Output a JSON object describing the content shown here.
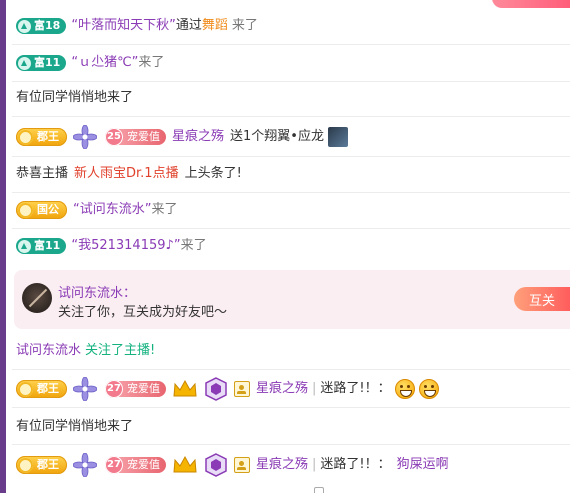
{
  "feed": {
    "rows": [
      {
        "badge_level": "富18",
        "user": "叶落而知天下秋",
        "action_pre": "通过",
        "source": "舞蹈",
        "action_post": "来了"
      },
      {
        "badge_level": "富11",
        "user": "ｕ尐猪℃",
        "action_post": "来了"
      },
      {
        "text": "有位同学悄悄地来了"
      },
      {
        "badge": "郡王",
        "love_level": "25",
        "love_label": "宠爱值",
        "user": "星痕之殇",
        "gift_text": "送1个翔翼•应龙"
      },
      {
        "pre": "恭喜主播",
        "anchor": "新人雨宝Dr.1点播",
        "post": "上头条了!"
      },
      {
        "badge": "国公",
        "user": "试问东流水",
        "action_post": "来了"
      },
      {
        "badge_level": "富11",
        "user": "我521314159♪",
        "action_post": "来了"
      },
      {
        "user": "试问东流水",
        "action": "关注了主播!"
      },
      {
        "badge": "郡王",
        "love_level": "27",
        "love_label": "宠爱值",
        "user": "星痕之殇",
        "sep": "|",
        "message": "迷路了!！："
      },
      {
        "text": "有位同学悄悄地来了"
      },
      {
        "badge": "郡王",
        "love_level": "27",
        "love_label": "宠爱值",
        "user": "星痕之殇",
        "sep": "|",
        "message": "迷路了!！：",
        "extra": "狗屎运啊"
      }
    ],
    "quote_open": "“",
    "quote_close": "”"
  },
  "follow_card": {
    "name": "试问东流水：",
    "message": "关注了你，互关成为好友吧～",
    "button_label": "互关"
  },
  "colors": {
    "left_bar": "#6a3c8c",
    "purple_name": "#8a3bb5",
    "green_badge": "#1aa78c",
    "gold_badge": "#f0a30a",
    "card_bg": "#fbeef3",
    "button": "#ff5d5d"
  }
}
